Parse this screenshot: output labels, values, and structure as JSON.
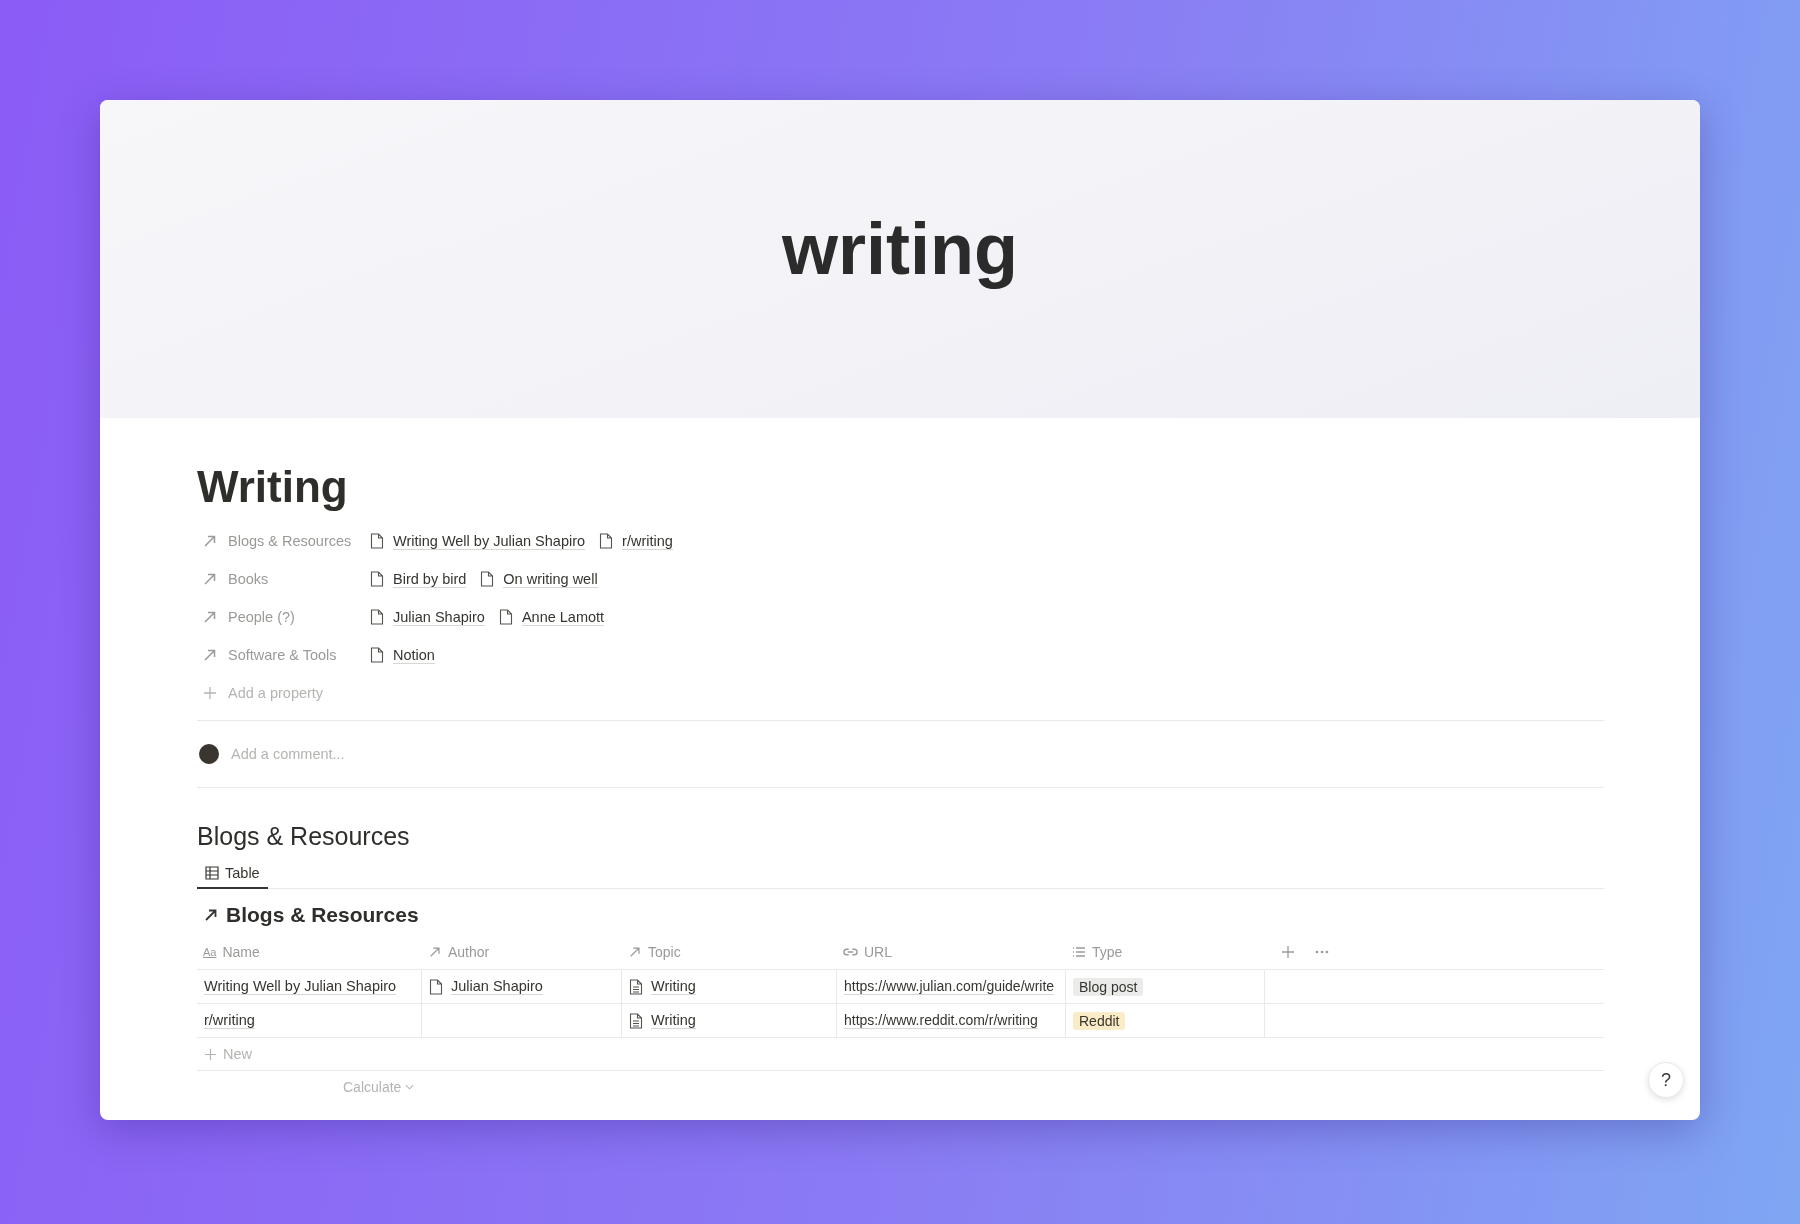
{
  "cover": {
    "title": "writing"
  },
  "page": {
    "title": "Writing"
  },
  "properties": [
    {
      "label": "Blogs & Resources",
      "values": [
        "Writing Well by Julian Shapiro",
        "r/writing"
      ]
    },
    {
      "label": "Books",
      "values": [
        "Bird by bird",
        "On writing well"
      ]
    },
    {
      "label": "People (?)",
      "values": [
        "Julian Shapiro",
        "Anne Lamott"
      ]
    },
    {
      "label": "Software & Tools",
      "values": [
        "Notion"
      ]
    }
  ],
  "add_property": "Add a property",
  "comment": {
    "placeholder": "Add a comment..."
  },
  "section": {
    "title": "Blogs & Resources",
    "views": [
      {
        "label": "Table",
        "selected": true
      }
    ],
    "table": {
      "title": "Blogs & Resources",
      "columns": [
        {
          "label": "Name",
          "kind": "title",
          "icon": "Aa"
        },
        {
          "label": "Author",
          "kind": "relation"
        },
        {
          "label": "Topic",
          "kind": "relation"
        },
        {
          "label": "URL",
          "kind": "url"
        },
        {
          "label": "Type",
          "kind": "select"
        }
      ],
      "rows": [
        {
          "name": "Writing Well by Julian Shapiro",
          "author": "Julian Shapiro",
          "topic": "Writing",
          "url": "https://www.julian.com/guide/write",
          "type": {
            "label": "Blog post",
            "color": "#ebebea"
          }
        },
        {
          "name": "r/writing",
          "topic": "Writing",
          "url": "https://www.reddit.com/r/writing",
          "type": {
            "label": "Reddit",
            "color": "#fbecc8"
          }
        }
      ],
      "new_row": "New",
      "calculate": "Calculate"
    }
  },
  "help": "?"
}
